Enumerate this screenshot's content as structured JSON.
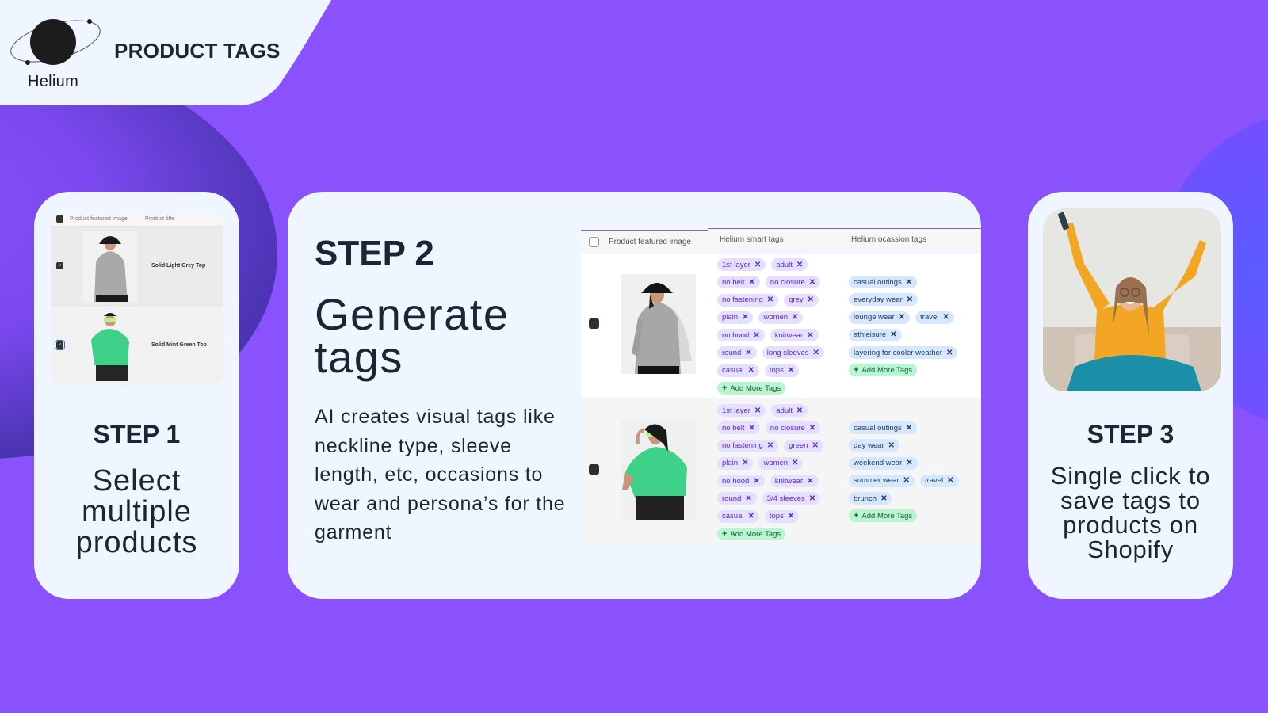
{
  "header": {
    "logo_text": "Helium",
    "title": "PRODUCT TAGS"
  },
  "colors": {
    "background": "#8a52fd",
    "card": "#eff6ff",
    "smart_tag_bg": "#e6e0ff",
    "smart_tag_text": "#5a2ad0",
    "occasion_tag_bg": "#d6e8ff",
    "add_tag_bg": "#b8f5d0"
  },
  "step1": {
    "label": "STEP 1",
    "description": "Select multiple products",
    "table": {
      "columns": [
        "Product featured image",
        "Product title"
      ],
      "rows": [
        {
          "title": "Solid Light Grey Top",
          "checked": true
        },
        {
          "title": "Solid Mint Green Top",
          "checked": true
        }
      ]
    }
  },
  "step2": {
    "label": "STEP 2",
    "title": "Generate tags",
    "body": "AI creates visual tags like neckline type, sleeve length, etc, occasions to wear and persona’s for the garment",
    "table": {
      "columns": [
        "Product featured image",
        "Helium smart tags",
        "Helium ocassion tags"
      ],
      "add_label": "Add More Tags",
      "rows": [
        {
          "product": "Solid Light Grey Top",
          "smart_tags": [
            [
              "1st layer",
              "adult"
            ],
            [
              "no belt",
              "no closure"
            ],
            [
              "no fastening",
              "grey"
            ],
            [
              "plain",
              "women"
            ],
            [
              "no hood",
              "knitwear"
            ],
            [
              "round",
              "long sleeves"
            ],
            [
              "casual",
              "tops"
            ]
          ],
          "occasion_tags": [
            [
              "casual outings"
            ],
            [
              "everyday wear"
            ],
            [
              "lounge wear",
              "travel"
            ],
            [
              "athleisure"
            ],
            [
              "layering for cooler weather"
            ]
          ]
        },
        {
          "product": "Solid Mint Green Top",
          "smart_tags": [
            [
              "1st layer",
              "adult"
            ],
            [
              "no belt",
              "no closure"
            ],
            [
              "no fastening",
              "green"
            ],
            [
              "plain",
              "women"
            ],
            [
              "no hood",
              "knitwear"
            ],
            [
              "round",
              "3/4 sleeves"
            ],
            [
              "casual",
              "tops"
            ]
          ],
          "occasion_tags": [
            [
              "casual outings"
            ],
            [
              "day wear"
            ],
            [
              "weekend wear"
            ],
            [
              "summer wear",
              "travel"
            ],
            [
              "brunch"
            ]
          ]
        }
      ]
    }
  },
  "step3": {
    "label": "STEP 3",
    "description": "Single click to save tags to products on Shopify"
  }
}
